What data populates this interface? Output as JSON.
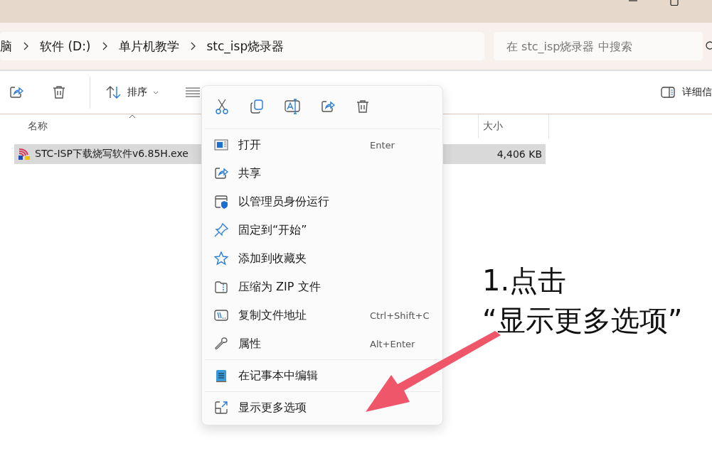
{
  "address_bar": {
    "breadcrumbs": [
      "脑",
      "软件 (D:)",
      "单片机教学",
      "stc_isp烧录器"
    ]
  },
  "search": {
    "placeholder": "在 stc_isp烧录器 中搜索"
  },
  "toolbar": {
    "sort_label": "排序",
    "details_label": "详细信"
  },
  "table": {
    "columns": [
      "名称",
      "大小"
    ],
    "rows": [
      {
        "name": "STC-ISP下载烧写软件v6.85H.exe",
        "size": "4,406 KB",
        "selected": true
      }
    ]
  },
  "context_menu": {
    "groups": [
      [
        {
          "label": "打开",
          "shortcut": "Enter"
        },
        {
          "label": "共享"
        },
        {
          "label": "以管理员身份运行"
        },
        {
          "label": "固定到“开始”"
        },
        {
          "label": "添加到收藏夹"
        },
        {
          "label": "压缩为 ZIP 文件"
        },
        {
          "label": "复制文件地址",
          "shortcut": "Ctrl+Shift+C"
        },
        {
          "label": "属性",
          "shortcut": "Alt+Enter"
        }
      ],
      [
        {
          "label": "在记事本中编辑"
        }
      ],
      [
        {
          "label": "显示更多选项"
        }
      ]
    ]
  },
  "annotation": {
    "lines": [
      "1.点击",
      "“显示更多选项”"
    ]
  }
}
